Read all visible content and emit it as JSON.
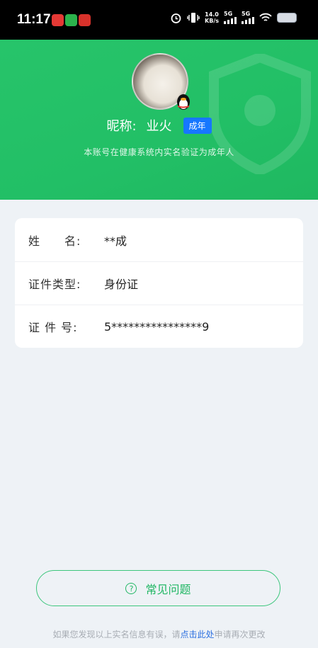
{
  "status_bar": {
    "time": "11:17",
    "net_speed_value": "14.0",
    "net_speed_unit": "KB/s",
    "signal1": "5G",
    "signal2": "5G"
  },
  "profile": {
    "nickname_label": "昵称:",
    "nickname": "业火",
    "age_badge": "成年",
    "verify_note": "本账号在健康系统内实名验证为成年人"
  },
  "info": {
    "rows": [
      {
        "label": "姓　　名:",
        "value": "**成"
      },
      {
        "label": "证件类型:",
        "value": "身份证"
      },
      {
        "label": "证 件 号:",
        "value": "5****************9"
      }
    ]
  },
  "faq": {
    "label": "常见问题",
    "icon": "question-circle-icon"
  },
  "footer": {
    "text_before": "如果您发现以上实名信息有误，请",
    "link": "点击此处",
    "text_after": "申请再次更改"
  },
  "colors": {
    "header_green": "#22bf66",
    "badge_blue": "#1677ff",
    "link_blue": "#2b6fe0",
    "faq_green": "#22b765"
  }
}
